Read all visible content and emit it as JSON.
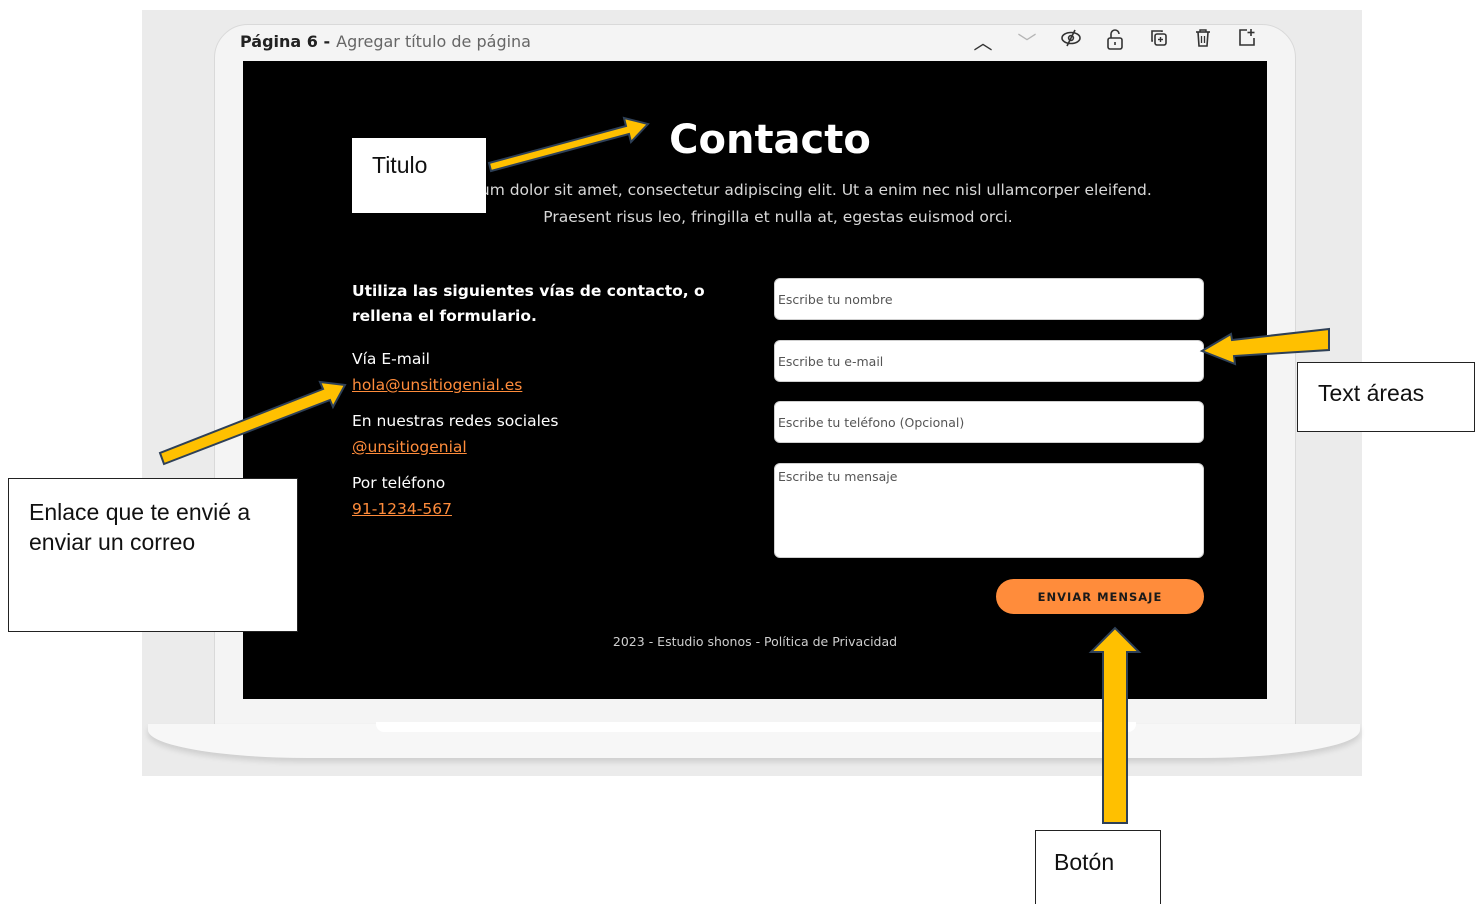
{
  "toolbar": {
    "page_label": "Página 6 -",
    "title_placeholder": "Agregar título de página",
    "icons": [
      "chevron-up-icon",
      "chevron-down-icon",
      "eye-hidden-icon",
      "lock-open-icon",
      "duplicate-icon",
      "trash-icon",
      "add-page-icon"
    ]
  },
  "page": {
    "title": "Contacto",
    "intro": "Lorem ipsum dolor sit amet, consectetur adipiscing elit. Ut a enim nec nisl ullamcorper eleifend. Praesent risus leo, fringilla et nulla at, egestas euismod orci.",
    "contact_heading": "Utiliza las siguientes vías de contacto, o rellena el formulario.",
    "email_label": "Vía E-mail",
    "email_link": "hola@unsitiogenial.es",
    "social_label": "En nuestras redes sociales",
    "social_link": "@unsitiogenial",
    "phone_label": "Por teléfono",
    "phone_link": "91-1234-567",
    "form": {
      "name_placeholder": "Escribe tu nombre",
      "email_placeholder": "Escribe tu e-mail",
      "phone_placeholder": "Escribe tu teléfono (Opcional)",
      "message_placeholder": "Escribe tu mensaje",
      "submit_label": "ENVIAR MENSAJE"
    },
    "footer": "2023 - Estudio shonos - Política de Privacidad"
  },
  "annotations": {
    "titulo": "Titulo",
    "text_areas": "Text áreas",
    "enlace": "Enlace que te envié a enviar un correo",
    "boton": "Botón"
  },
  "colors": {
    "accent": "#ff8c3b",
    "arrow_fill": "#ffc000",
    "arrow_stroke": "#2e4057",
    "screen_bg": "#000000"
  }
}
